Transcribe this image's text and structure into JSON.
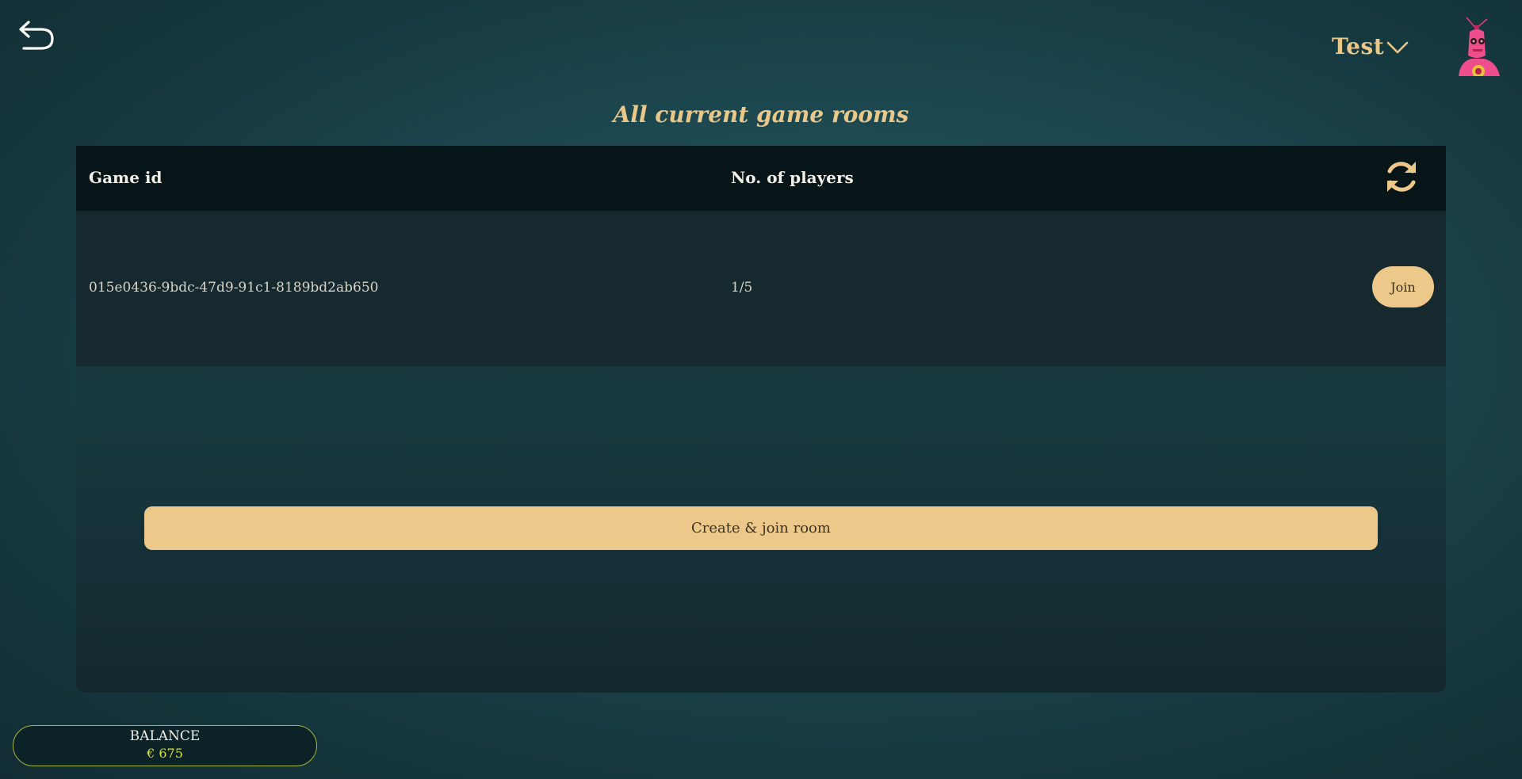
{
  "header": {
    "back_icon": "undo-arrow-icon",
    "user_name": "Test",
    "user_menu_icon": "chevron-down-icon",
    "avatar_icon": "pink-robot-avatar"
  },
  "page": {
    "title": "All current game rooms"
  },
  "table": {
    "columns": [
      "Game id",
      "No. of players"
    ],
    "refresh_icon": "refresh-icon",
    "rows": [
      {
        "game_id": "015e0436-9bdc-47d9-91c1-8189bd2ab650",
        "players": "1/5",
        "action_label": "Join"
      }
    ]
  },
  "actions": {
    "create_label": "Create & join room"
  },
  "balance": {
    "label": "BALANCE",
    "value": "€ 675"
  },
  "colors": {
    "accent": "#ecc98a",
    "title": "#e9c88a",
    "balance_value": "#d9e23a",
    "balance_border": "#a8b838"
  }
}
